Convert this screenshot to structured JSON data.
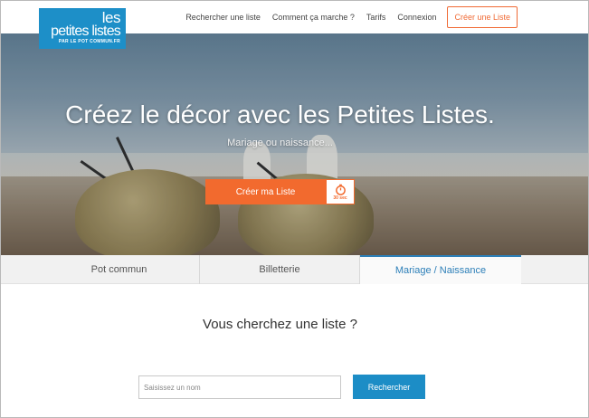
{
  "logo": {
    "line1": "les",
    "line2": "petites listes",
    "line3": "PAR LE POT COMMUN.FR"
  },
  "nav": {
    "items": [
      "Rechercher une liste",
      "Comment ça marche ?",
      "Tarifs",
      "Connexion"
    ],
    "cta": "Créer une Liste"
  },
  "hero": {
    "title": "Créez le décor avec les Petites Listes.",
    "subtitle": "Mariage ou naissance...",
    "button": "Créer ma Liste",
    "timer_label": "30 sec",
    "colors": {
      "button": "#f26a2e"
    }
  },
  "tabs": [
    {
      "label": "Pot commun",
      "active": false
    },
    {
      "label": "Billetterie",
      "active": false
    },
    {
      "label": "Mariage / Naissance",
      "active": true
    }
  ],
  "search": {
    "title": "Vous cherchez une liste ?",
    "placeholder": "Saisissez un nom",
    "value": "",
    "button": "Rechercher",
    "colors": {
      "button": "#1c8dc6"
    }
  }
}
